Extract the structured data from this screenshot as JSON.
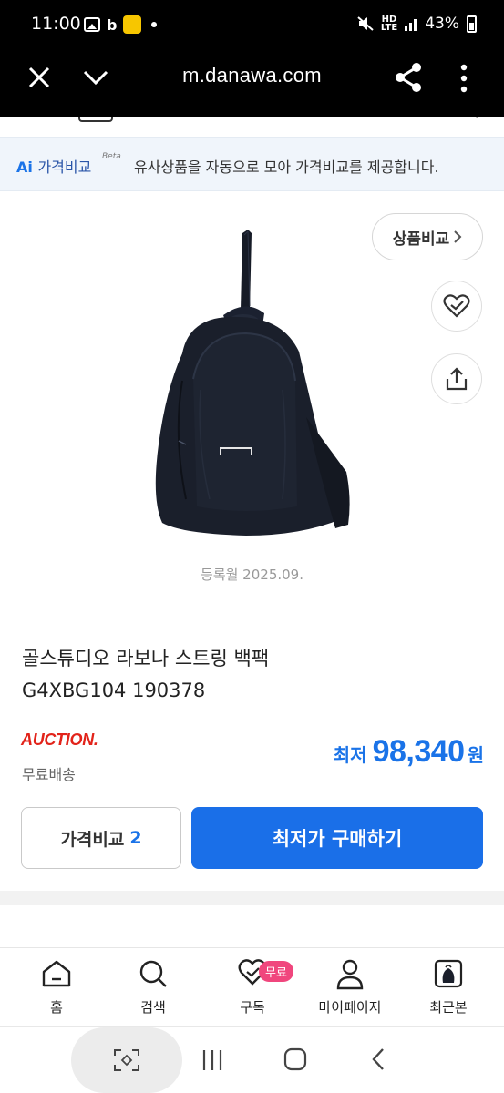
{
  "status_bar": {
    "time": "11:00",
    "left_icons": [
      "gallery-icon",
      "b-icon",
      "kakao-icon",
      "dot-icon"
    ],
    "network_label": "HD Voice LTE",
    "battery": "43%"
  },
  "browser": {
    "url": "m.danawa.com",
    "icons": [
      "close-icon",
      "chevron-down-icon",
      "share-icon",
      "more-vertical-icon"
    ]
  },
  "ai_banner": {
    "brand": "Ai",
    "title": "가격비교",
    "beta": "Beta",
    "text": "유사상품을 자동으로 모아 가격비교를 제공합니다."
  },
  "product": {
    "compare_label": "상품비교",
    "registered": "등록월 2025.09.",
    "title_line1": "골스튜디오 라보나 스트링 백팩",
    "title_line2": "G4XBG104 190378",
    "seller": "AUCTION.",
    "shipping": "무료배송",
    "price_label": "최저",
    "price": "98,340",
    "price_unit": "원"
  },
  "actions": {
    "compare_label": "가격비교",
    "compare_count": "2",
    "buy_label": "최저가 구매하기"
  },
  "tabbar": {
    "items": [
      {
        "label": "홈",
        "icon": "home-icon"
      },
      {
        "label": "검색",
        "icon": "search-icon"
      },
      {
        "label": "구독",
        "icon": "heart-icon",
        "badge": "무료"
      },
      {
        "label": "마이페이지",
        "icon": "user-icon"
      },
      {
        "label": "최근본",
        "icon": "recent-product-icon"
      }
    ]
  },
  "colors": {
    "accent": "#1a6fe8",
    "seller_red": "#e2231a",
    "badge_pink": "#f0467d"
  }
}
